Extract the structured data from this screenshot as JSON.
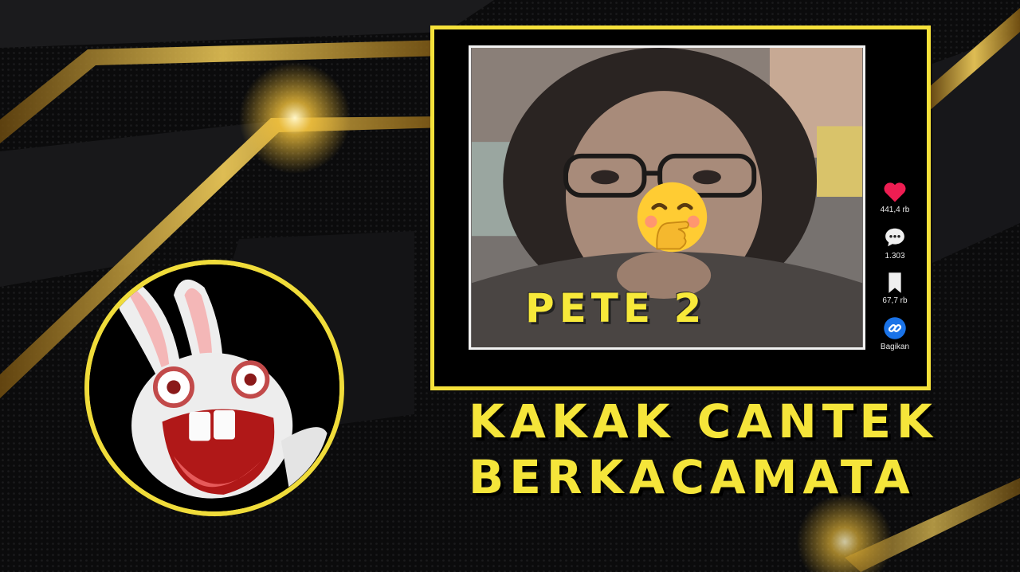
{
  "video": {
    "title": "PETE 2",
    "actions": [
      {
        "name": "like",
        "icon": "heart-icon",
        "count": "441,4 rb"
      },
      {
        "name": "comment",
        "icon": "comment-icon",
        "count": "1.303"
      },
      {
        "name": "bookmark",
        "icon": "bookmark-icon",
        "count": "67,7 rb"
      },
      {
        "name": "share",
        "icon": "link-icon",
        "count": "Bagikan"
      }
    ],
    "face_sticker": "hand-over-mouth-emoji"
  },
  "caption": {
    "line1": "KAKAK CANTEK",
    "line2": "BERKACAMATA"
  },
  "avatar": {
    "icon": "rabbid-character"
  },
  "colors": {
    "accent": "#f5e13a",
    "background": "#0b0b0c",
    "like": "#ee1d52",
    "share": "#1a73e8"
  }
}
